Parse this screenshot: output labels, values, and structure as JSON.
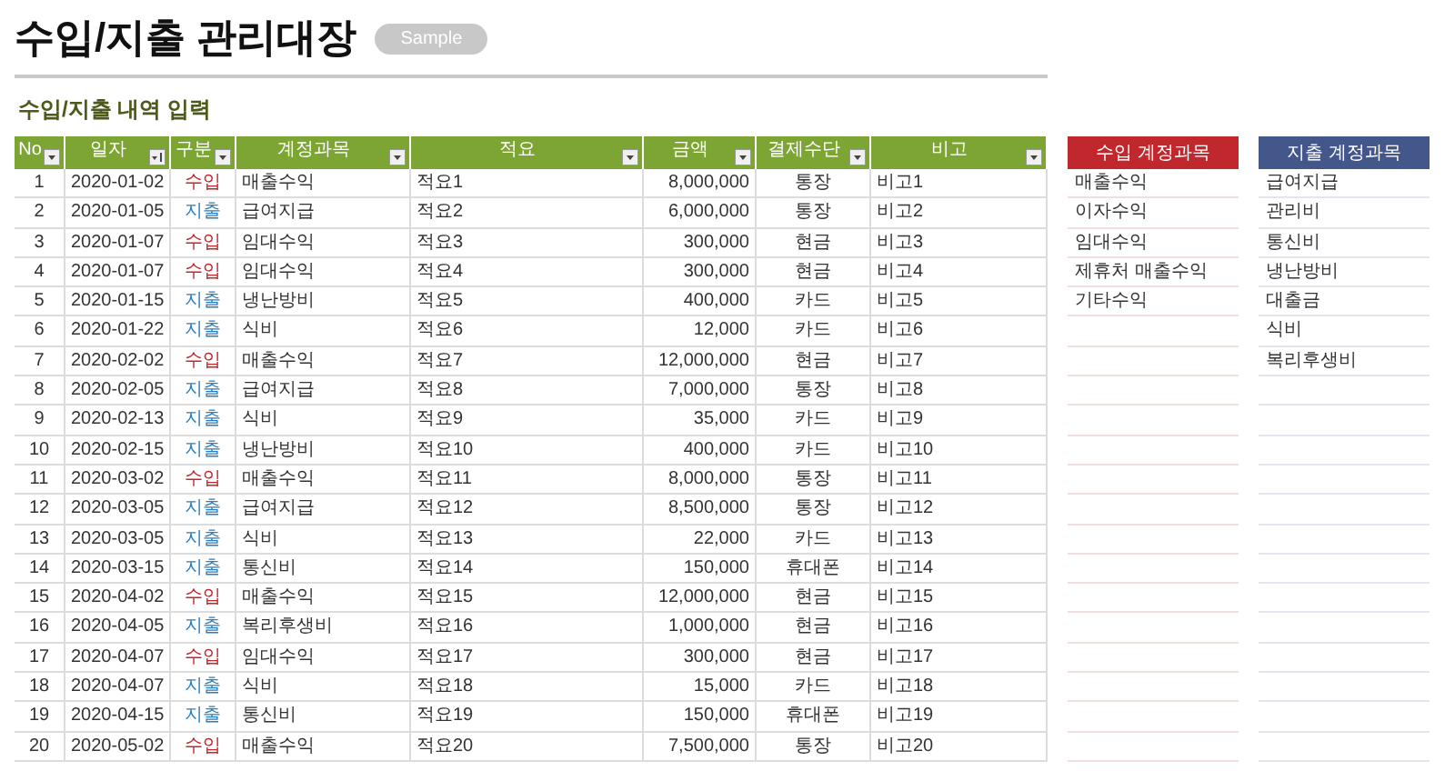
{
  "title": "수입/지출 관리대장",
  "badge": "Sample",
  "section_title": "수입/지출 내역 입력",
  "table": {
    "columns": [
      {
        "label": "No",
        "kind": "dropdown"
      },
      {
        "label": "일자",
        "kind": "sorted"
      },
      {
        "label": "구분",
        "kind": "dropdown"
      },
      {
        "label": "계정과목",
        "kind": "dropdown"
      },
      {
        "label": "적요",
        "kind": "dropdown"
      },
      {
        "label": "금액",
        "kind": "dropdown"
      },
      {
        "label": "결제수단",
        "kind": "dropdown"
      },
      {
        "label": "비고",
        "kind": "dropdown"
      }
    ],
    "rows": [
      {
        "no": "1",
        "date": "2020-01-02",
        "type": "수입",
        "kind": "income",
        "account": "매출수익",
        "memo": "적요1",
        "amount": "8,000,000",
        "payment": "통장",
        "note": "비고1"
      },
      {
        "no": "2",
        "date": "2020-01-05",
        "type": "지출",
        "kind": "expense",
        "account": "급여지급",
        "memo": "적요2",
        "amount": "6,000,000",
        "payment": "통장",
        "note": "비고2"
      },
      {
        "no": "3",
        "date": "2020-01-07",
        "type": "수입",
        "kind": "income",
        "account": "임대수익",
        "memo": "적요3",
        "amount": "300,000",
        "payment": "현금",
        "note": "비고3"
      },
      {
        "no": "4",
        "date": "2020-01-07",
        "type": "수입",
        "kind": "income",
        "account": "임대수익",
        "memo": "적요4",
        "amount": "300,000",
        "payment": "현금",
        "note": "비고4"
      },
      {
        "no": "5",
        "date": "2020-01-15",
        "type": "지출",
        "kind": "expense",
        "account": "냉난방비",
        "memo": "적요5",
        "amount": "400,000",
        "payment": "카드",
        "note": "비고5"
      },
      {
        "no": "6",
        "date": "2020-01-22",
        "type": "지출",
        "kind": "expense",
        "account": "식비",
        "memo": "적요6",
        "amount": "12,000",
        "payment": "카드",
        "note": "비고6"
      },
      {
        "no": "7",
        "date": "2020-02-02",
        "type": "수입",
        "kind": "income",
        "account": "매출수익",
        "memo": "적요7",
        "amount": "12,000,000",
        "payment": "현금",
        "note": "비고7"
      },
      {
        "no": "8",
        "date": "2020-02-05",
        "type": "지출",
        "kind": "expense",
        "account": "급여지급",
        "memo": "적요8",
        "amount": "7,000,000",
        "payment": "통장",
        "note": "비고8"
      },
      {
        "no": "9",
        "date": "2020-02-13",
        "type": "지출",
        "kind": "expense",
        "account": "식비",
        "memo": "적요9",
        "amount": "35,000",
        "payment": "카드",
        "note": "비고9"
      },
      {
        "no": "10",
        "date": "2020-02-15",
        "type": "지출",
        "kind": "expense",
        "account": "냉난방비",
        "memo": "적요10",
        "amount": "400,000",
        "payment": "카드",
        "note": "비고10"
      },
      {
        "no": "11",
        "date": "2020-03-02",
        "type": "수입",
        "kind": "income",
        "account": "매출수익",
        "memo": "적요11",
        "amount": "8,000,000",
        "payment": "통장",
        "note": "비고11"
      },
      {
        "no": "12",
        "date": "2020-03-05",
        "type": "지출",
        "kind": "expense",
        "account": "급여지급",
        "memo": "적요12",
        "amount": "8,500,000",
        "payment": "통장",
        "note": "비고12"
      },
      {
        "no": "13",
        "date": "2020-03-05",
        "type": "지출",
        "kind": "expense",
        "account": "식비",
        "memo": "적요13",
        "amount": "22,000",
        "payment": "카드",
        "note": "비고13"
      },
      {
        "no": "14",
        "date": "2020-03-15",
        "type": "지출",
        "kind": "expense",
        "account": "통신비",
        "memo": "적요14",
        "amount": "150,000",
        "payment": "휴대폰",
        "note": "비고14"
      },
      {
        "no": "15",
        "date": "2020-04-02",
        "type": "수입",
        "kind": "income",
        "account": "매출수익",
        "memo": "적요15",
        "amount": "12,000,000",
        "payment": "현금",
        "note": "비고15"
      },
      {
        "no": "16",
        "date": "2020-04-05",
        "type": "지출",
        "kind": "expense",
        "account": "복리후생비",
        "memo": "적요16",
        "amount": "1,000,000",
        "payment": "현금",
        "note": "비고16"
      },
      {
        "no": "17",
        "date": "2020-04-07",
        "type": "수입",
        "kind": "income",
        "account": "임대수익",
        "memo": "적요17",
        "amount": "300,000",
        "payment": "현금",
        "note": "비고17"
      },
      {
        "no": "18",
        "date": "2020-04-07",
        "type": "지출",
        "kind": "expense",
        "account": "식비",
        "memo": "적요18",
        "amount": "15,000",
        "payment": "카드",
        "note": "비고18"
      },
      {
        "no": "19",
        "date": "2020-04-15",
        "type": "지출",
        "kind": "expense",
        "account": "통신비",
        "memo": "적요19",
        "amount": "150,000",
        "payment": "휴대폰",
        "note": "비고19"
      },
      {
        "no": "20",
        "date": "2020-05-02",
        "type": "수입",
        "kind": "income",
        "account": "매출수익",
        "memo": "적요20",
        "amount": "7,500,000",
        "payment": "통장",
        "note": "비고20"
      }
    ]
  },
  "account_lists": [
    {
      "title": "수입 계정과목",
      "color": "#c0282d",
      "items": [
        "매출수익",
        "이자수익",
        "임대수익",
        "제휴처 매출수익",
        "기타수익"
      ]
    },
    {
      "title": "지출 계정과목",
      "color": "#44578a",
      "items": [
        "급여지급",
        "관리비",
        "통신비",
        "냉난방비",
        "대출금",
        "식비",
        "복리후생비"
      ]
    }
  ]
}
